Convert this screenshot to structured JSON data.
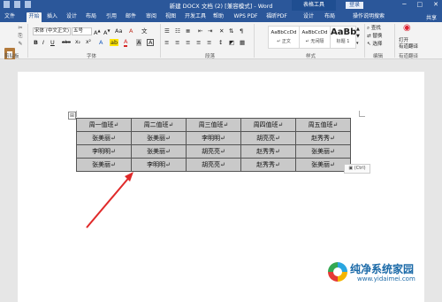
{
  "title_bar": {
    "document_title": "新建 DOCX 文档 (2) [兼容模式] - Word",
    "context_tab": "表格工具",
    "login_button": "登录",
    "window_controls": [
      "─",
      "□",
      "✕"
    ]
  },
  "tabs": [
    {
      "label": "文件"
    },
    {
      "label": "开始",
      "active": true
    },
    {
      "label": "插入"
    },
    {
      "label": "设计"
    },
    {
      "label": "布局"
    },
    {
      "label": "引用"
    },
    {
      "label": "邮件"
    },
    {
      "label": "审阅"
    },
    {
      "label": "视图"
    },
    {
      "label": "开发工具"
    },
    {
      "label": "帮助"
    },
    {
      "label": "WPS PDF"
    },
    {
      "label": "福昕PDF"
    },
    {
      "label": "设计"
    },
    {
      "label": "布局"
    },
    {
      "label": "操作说明搜索"
    }
  ],
  "share_label": "共享",
  "ribbon": {
    "paste_label": "粘贴",
    "font_name": "宋体 (中文正文)",
    "font_size": "五号",
    "format_buttons": [
      "B",
      "I",
      "U",
      "abc",
      "x₂",
      "x²",
      "A"
    ],
    "styles": [
      {
        "sample": "AaBbCcDd",
        "name": "↵ 正文"
      },
      {
        "sample": "AaBbCcDd",
        "name": "↵ 无间隔"
      },
      {
        "sample": "AaBb",
        "name": "标题 1"
      }
    ],
    "edit_items": [
      "查找",
      "替换",
      "选择"
    ],
    "open_label": "打开",
    "addin_label": "有道翻译",
    "group_labels": [
      "剪贴板",
      "字体",
      "段落",
      "样式",
      "编辑",
      "有道翻译"
    ]
  },
  "document": {
    "table_rows": [
      [
        "周一值班↵",
        "周二值班↵",
        "周三值班↵",
        "周四值班↵",
        "周五值班↵"
      ],
      [
        "张美丽↵",
        "张美丽↵",
        "李明明↵",
        "胡亮亮↵",
        "赵秀秀↵"
      ],
      [
        "李明明↵",
        "张美丽↵",
        "胡亮亮↵",
        "赵秀秀↵",
        "张美丽↵"
      ],
      [
        "张美丽↵",
        "李明明↵",
        "胡亮亮↵",
        "赵秀秀↵",
        "张美丽↵"
      ]
    ],
    "table_handle": "⊞",
    "paste_options": "(Ctrl)"
  },
  "watermark": {
    "site_name": "纯净系统家园",
    "url": "www.yidaimei.com"
  },
  "colors": {
    "title_bar": "#2b579a",
    "table_fill": "#c9c9c9",
    "arrow": "#e02a2a"
  }
}
